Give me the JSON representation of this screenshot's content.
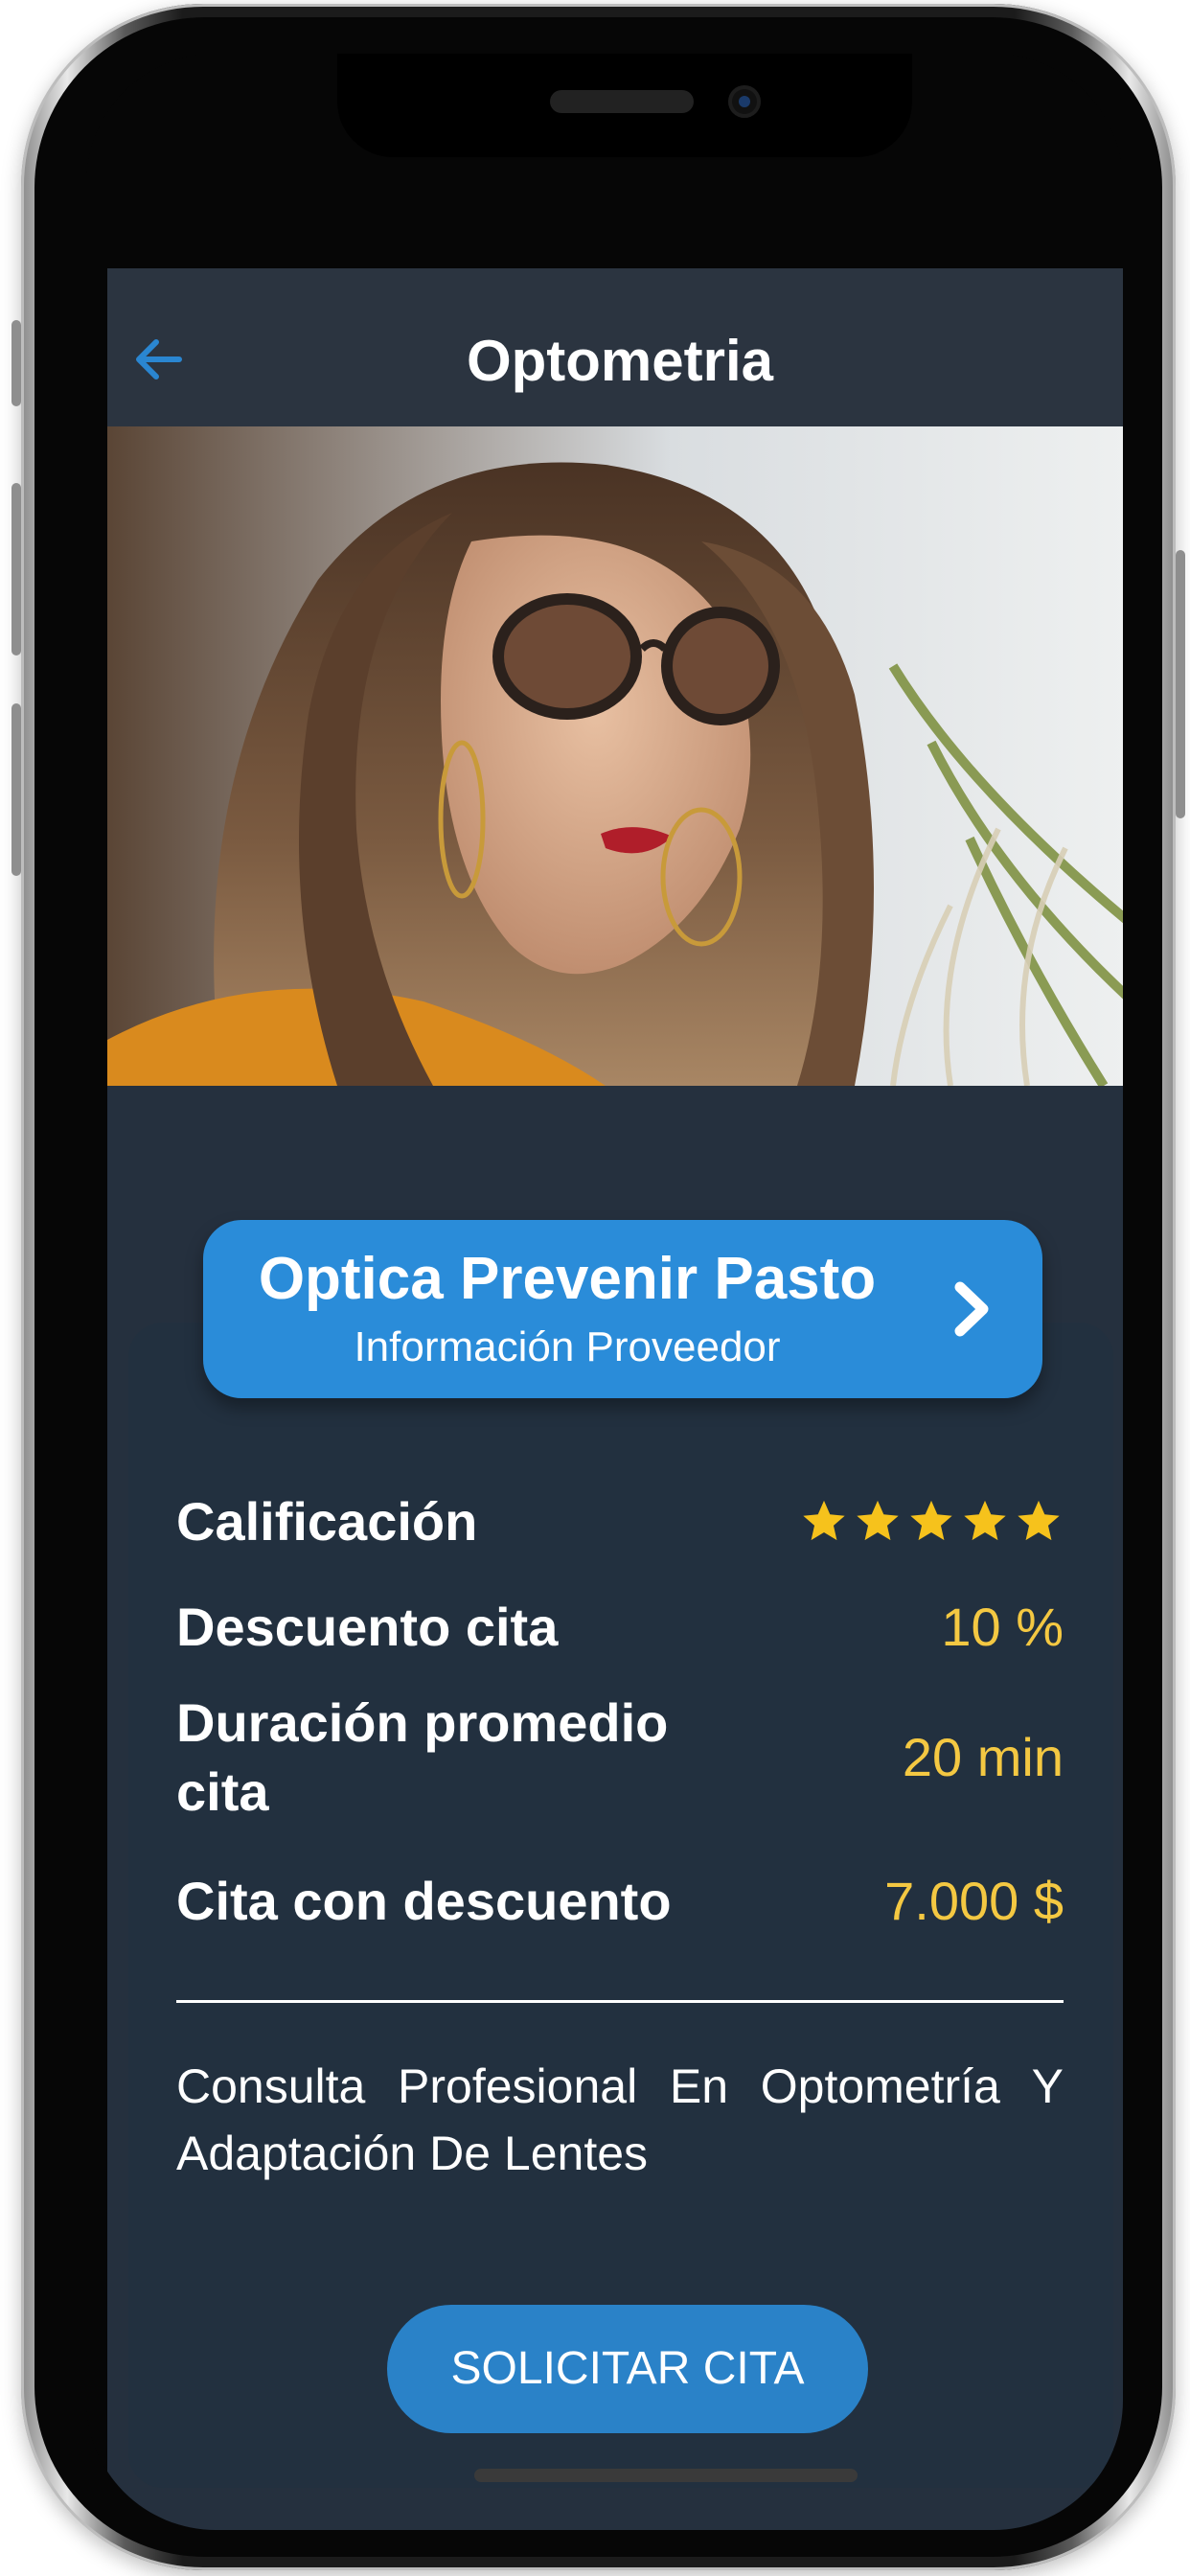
{
  "header": {
    "title": "Optometria",
    "back_icon": "arrow-left-icon"
  },
  "provider": {
    "name": "Optica Prevenir Pasto",
    "subtitle": "Información Proveedor",
    "chevron_icon": "chevron-right-icon"
  },
  "details": {
    "rating_label": "Calificación",
    "rating_value": 5,
    "rating_max": 5,
    "discount_label": "Descuento cita",
    "discount_value": "10 %",
    "duration_label": "Duración promedio cita",
    "duration_value": "20 min",
    "price_label": "Cita con descuento",
    "price_value": "7.000 $"
  },
  "description": "Consulta Profesional En Optometría Y Adaptación De Lentes",
  "cta": {
    "label": "SOLICITAR CITA"
  },
  "colors": {
    "accent": "#2a8cd9",
    "value": "#f4c842",
    "background": "#25303e",
    "card": "#22303f"
  }
}
